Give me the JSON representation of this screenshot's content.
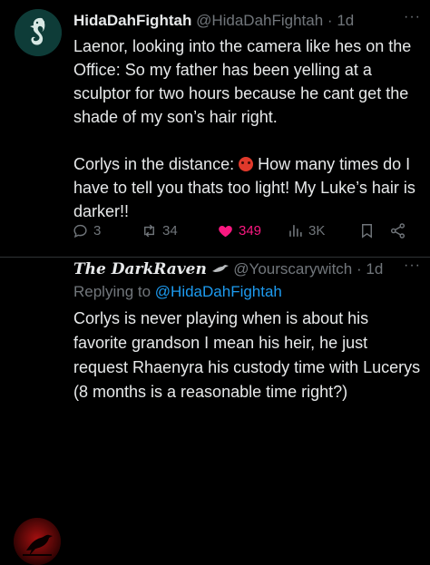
{
  "tweet1": {
    "display_name": "HidaDahFightah",
    "handle": "@HidaDahFightah",
    "dot": "·",
    "time": "1d",
    "more": "···",
    "body": "Laenor, looking into the camera like hes on the Office: So my father has been yelling at a sculptor for two hours because he cant get the shade of my son’s hair right.\n\nCorlys in the distance: ",
    "body_after_emoji": " How many times do I have to tell you thats too light! My Luke’s hair is darker!!",
    "replies": "3",
    "reposts": "34",
    "likes": "349",
    "views": "3K",
    "colors": {
      "like": "#f91880",
      "muted": "#71767b",
      "avatar_bg": "#0e3c38",
      "avatar_icon": "#d8e8e4"
    },
    "icons": [
      "reply-icon",
      "repost-icon",
      "heart-icon",
      "views-icon",
      "bookmark-icon",
      "share-icon",
      "seahorse-icon",
      "angry-face-emoji"
    ]
  },
  "tweet2": {
    "display_name": "The DarkRaven",
    "handle": "@Yourscarywitch",
    "dot": "·",
    "time": "1d",
    "more": "···",
    "replying_prefix": "Replying to ",
    "replying_to": "@HidaDahFightah",
    "body": "Corlys is never playing when is about his favorite grandson I mean his heir, he just request Rhaenyra his custody time with Lucerys (8 months is a reasonable time right?)",
    "colors": {
      "link": "#1d9bf0",
      "avatar_bg": "#3a0303"
    },
    "icons": [
      "raven-icon",
      "raven-avatar-icon"
    ]
  }
}
